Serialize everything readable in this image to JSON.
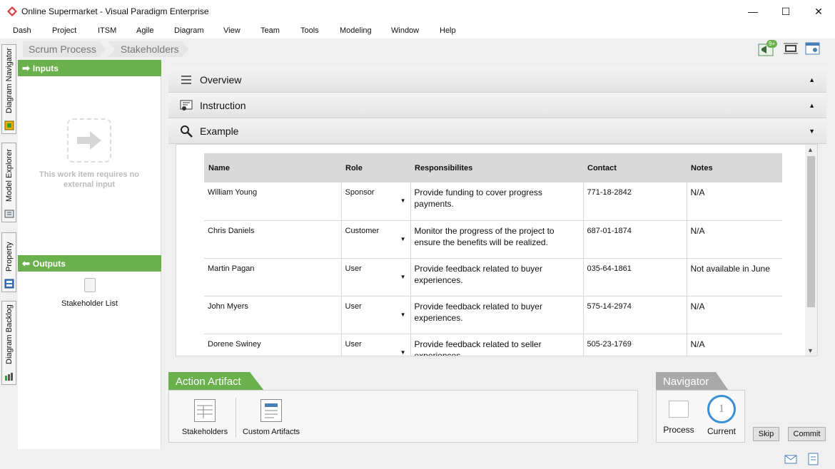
{
  "window": {
    "title": "Online Supermarket - Visual Paradigm Enterprise",
    "controls": {
      "minimize": "—",
      "maximize": "☐",
      "close": "✕"
    }
  },
  "menu": [
    "Dash",
    "Project",
    "ITSM",
    "Agile",
    "Diagram",
    "View",
    "Team",
    "Tools",
    "Modeling",
    "Window",
    "Help"
  ],
  "side_tabs": [
    "Diagram Navigator",
    "Model Explorer",
    "Property",
    "Diagram Backlog"
  ],
  "breadcrumb": [
    "Scrum Process",
    "Stakeholders"
  ],
  "toolbar": {
    "notification_badge": "9+"
  },
  "inputs": {
    "header": "Inputs",
    "empty_text": "This work item requires no external input"
  },
  "outputs": {
    "header": "Outputs",
    "items": [
      "Stakeholder List"
    ]
  },
  "sections": [
    {
      "label": "Overview",
      "icon": "list-icon",
      "state": "collapsed"
    },
    {
      "label": "Instruction",
      "icon": "instruction-icon",
      "state": "collapsed"
    },
    {
      "label": "Example",
      "icon": "magnifier-icon",
      "state": "expanded"
    }
  ],
  "example_table": {
    "columns": [
      "Name",
      "Role",
      "Responsibilites",
      "Contact",
      "Notes"
    ],
    "rows": [
      {
        "name": "William Young",
        "role": "Sponsor",
        "resp": "Provide funding to cover progress payments.",
        "contact": "771-18-2842",
        "notes": "N/A"
      },
      {
        "name": "Chris Daniels",
        "role": "Customer",
        "resp": "Monitor the progress of the project to ensure the benefits will be realized.",
        "contact": "687-01-1874",
        "notes": "N/A"
      },
      {
        "name": "Martin Pagan",
        "role": "User",
        "resp": "Provide feedback related to buyer experiences.",
        "contact": "035-64-1861",
        "notes": "Not available in June"
      },
      {
        "name": "John Myers",
        "role": "User",
        "resp": "Provide feedback related to buyer experiences.",
        "contact": "575-14-2974",
        "notes": "N/A"
      },
      {
        "name": "Dorene Swiney",
        "role": "User",
        "resp": "Provide feedback related to seller experiences.",
        "contact": "505-23-1769",
        "notes": "N/A"
      }
    ]
  },
  "action_artifact": {
    "header": "Action Artifact",
    "items": [
      "Stakeholders",
      "Custom Artifacts"
    ]
  },
  "navigator": {
    "header": "Navigator",
    "process_label": "Process",
    "current_label": "Current",
    "current_number": "1"
  },
  "buttons": {
    "skip": "Skip",
    "commit": "Commit"
  },
  "colors": {
    "green": "#6ab04c",
    "navigator_gray": "#a9a9a9",
    "current_ring": "#3a8fd6"
  }
}
